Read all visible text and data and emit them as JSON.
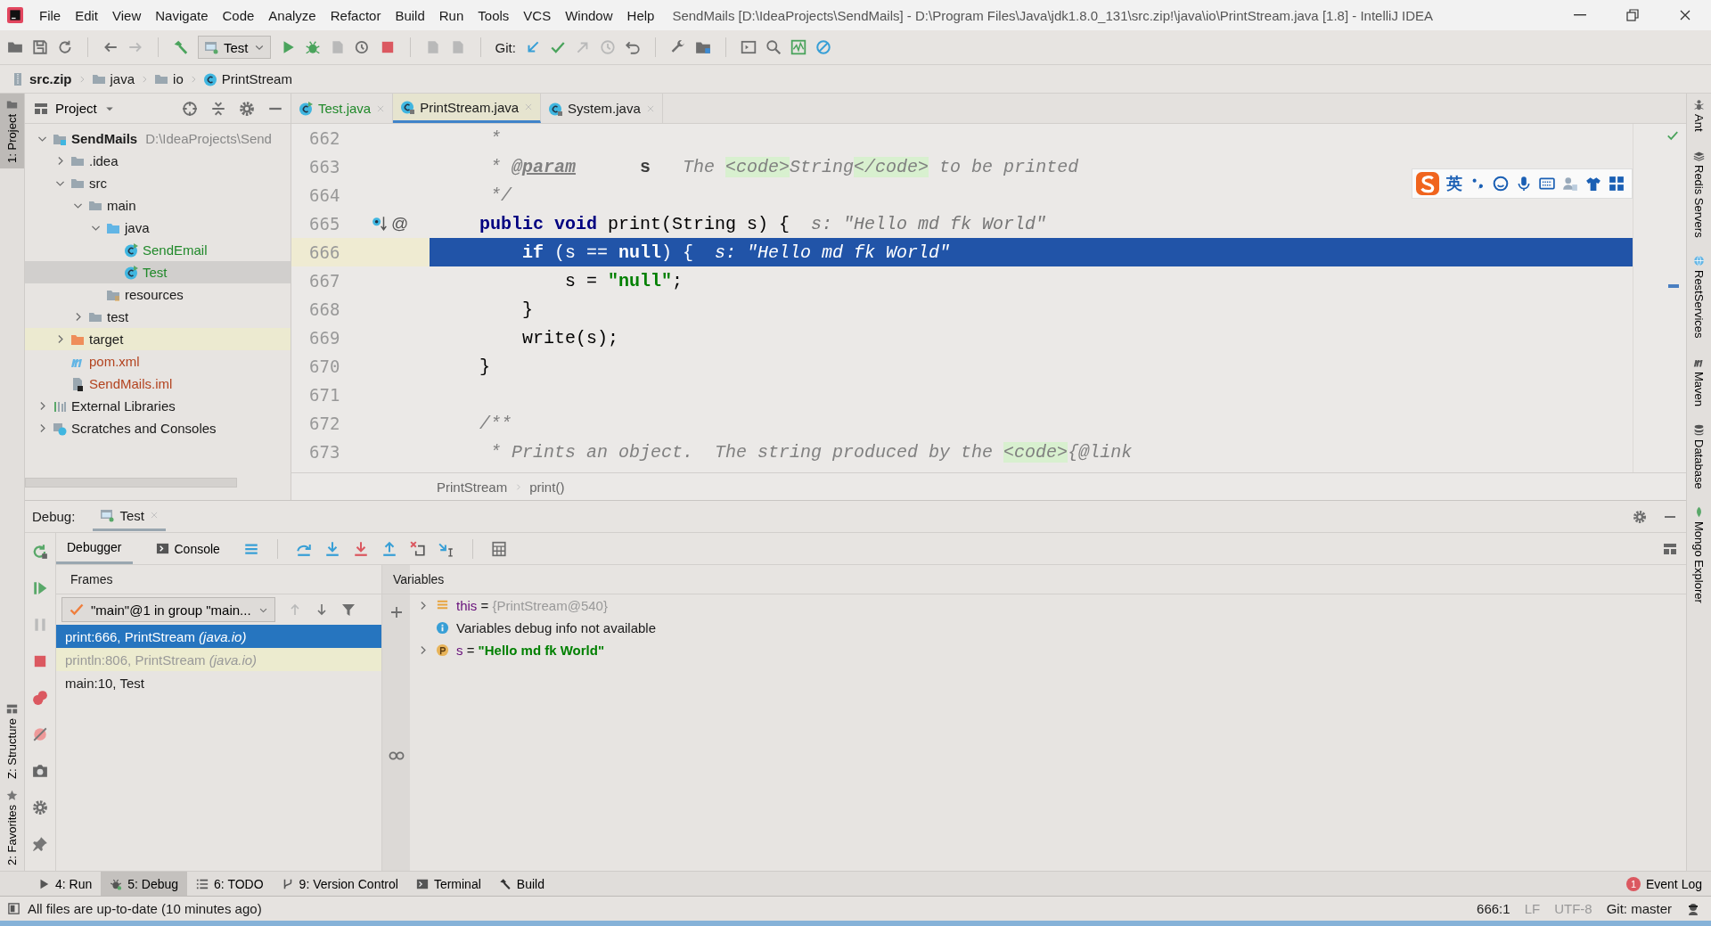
{
  "window": {
    "title": "SendMails [D:\\IdeaProjects\\SendMails] - D:\\Program Files\\Java\\jdk1.8.0_131\\src.zip!\\java\\io\\PrintStream.java [1.8] - IntelliJ IDEA"
  },
  "menu": [
    "File",
    "Edit",
    "View",
    "Navigate",
    "Code",
    "Analyze",
    "Refactor",
    "Build",
    "Run",
    "Tools",
    "VCS",
    "Window",
    "Help"
  ],
  "toolbar": {
    "run_config": "Test",
    "git_label": "Git:"
  },
  "navigation": [
    "src.zip",
    "java",
    "io",
    "PrintStream"
  ],
  "left_stripe": [
    {
      "label": "1: Project",
      "selected": true
    },
    {
      "label": "Z: Structure",
      "selected": false
    },
    {
      "label": "2: Favorites",
      "selected": false
    }
  ],
  "right_stripe": [
    "Ant",
    "Redis Servers",
    "RestServices",
    "Maven",
    "Database",
    "Mongo Explorer"
  ],
  "project": {
    "title": "Project",
    "tree": [
      {
        "label": "SendMails",
        "kind": "module",
        "path": "D:\\IdeaProjects\\Send",
        "expanded": true,
        "selected": false,
        "children": [
          {
            "label": ".idea",
            "kind": "folder",
            "expanded": false,
            "selected": false
          },
          {
            "label": "src",
            "kind": "folder",
            "expanded": true,
            "selected": false,
            "children": [
              {
                "label": "main",
                "kind": "folder",
                "expanded": true,
                "selected": false,
                "children": [
                  {
                    "label": "java",
                    "kind": "source",
                    "expanded": true,
                    "selected": false,
                    "children": [
                      {
                        "label": "SendEmail",
                        "kind": "class",
                        "selected": false
                      },
                      {
                        "label": "Test",
                        "kind": "class",
                        "selected": true
                      }
                    ]
                  },
                  {
                    "label": "resources",
                    "kind": "resources",
                    "selected": false
                  }
                ]
              },
              {
                "label": "test",
                "kind": "folder",
                "expanded": false,
                "selected": false
              }
            ]
          },
          {
            "label": "target",
            "kind": "excluded",
            "expanded": false,
            "selected": false
          },
          {
            "label": "pom.xml",
            "kind": "maven",
            "selected": false
          },
          {
            "label": "SendMails.iml",
            "kind": "iml",
            "selected": false
          }
        ]
      },
      {
        "label": "External Libraries",
        "kind": "libraries",
        "expanded": false,
        "selected": false
      },
      {
        "label": "Scratches and Consoles",
        "kind": "scratches",
        "expanded": false,
        "selected": false
      }
    ]
  },
  "editor": {
    "tabs": [
      {
        "label": "Test.java",
        "kind": "runnable",
        "selected": false
      },
      {
        "label": "PrintStream.java",
        "kind": "library",
        "selected": true
      },
      {
        "label": "System.java",
        "kind": "library",
        "selected": false
      }
    ],
    "lines": [
      {
        "number": "662",
        "current": false,
        "tokens": [
          {
            "kind": "comment",
            "text": "     *"
          }
        ]
      },
      {
        "number": "663",
        "current": false,
        "tokens": [
          {
            "kind": "comment",
            "text": "     * "
          },
          {
            "kind": "doctag",
            "text": "@param"
          },
          {
            "kind": "docparam",
            "text": "      s"
          },
          {
            "kind": "comment",
            "text": "   The "
          },
          {
            "kind": "html",
            "text": "<code>"
          },
          {
            "kind": "comment",
            "text": "String"
          },
          {
            "kind": "html",
            "text": "</code>"
          },
          {
            "kind": "comment",
            "text": " to be printed"
          }
        ]
      },
      {
        "number": "664",
        "current": false,
        "tokens": [
          {
            "kind": "comment",
            "text": "     */"
          }
        ]
      },
      {
        "number": "665",
        "current": false,
        "gutter_symbol": "@",
        "tokens": [
          {
            "kind": "keyword",
            "text": "    public void "
          },
          {
            "kind": "plain",
            "text": "print(String s) {  "
          },
          {
            "kind": "hint",
            "text": "s: \"Hello md fk World\""
          }
        ]
      },
      {
        "number": "666",
        "current": true,
        "tokens": [
          {
            "kind": "keyword",
            "text": "        if "
          },
          {
            "kind": "plain",
            "text": "(s == "
          },
          {
            "kind": "keyword",
            "text": "null"
          },
          {
            "kind": "plain",
            "text": ") {  "
          },
          {
            "kind": "hint",
            "text": "s: \"Hello md fk World\""
          }
        ]
      },
      {
        "number": "667",
        "current": false,
        "tokens": [
          {
            "kind": "plain",
            "text": "            s = "
          },
          {
            "kind": "string",
            "text": "\"null\""
          },
          {
            "kind": "plain",
            "text": ";"
          }
        ]
      },
      {
        "number": "668",
        "current": false,
        "tokens": [
          {
            "kind": "plain",
            "text": "        }"
          }
        ]
      },
      {
        "number": "669",
        "current": false,
        "tokens": [
          {
            "kind": "plain",
            "text": "        write(s);"
          }
        ]
      },
      {
        "number": "670",
        "current": false,
        "tokens": [
          {
            "kind": "plain",
            "text": "    }"
          }
        ]
      },
      {
        "number": "671",
        "current": false
      },
      {
        "number": "672",
        "current": false,
        "tokens": [
          {
            "kind": "comment",
            "text": "    /**"
          }
        ]
      },
      {
        "number": "673",
        "current": false,
        "tokens": [
          {
            "kind": "comment",
            "text": "     * Prints an object.  The string produced by the "
          },
          {
            "kind": "html",
            "text": "<code>"
          },
          {
            "kind": "comment",
            "text": "{@link"
          }
        ]
      }
    ],
    "breadcrumb": [
      "PrintStream",
      "print()"
    ]
  },
  "ime_toolbar": {
    "mode": "英"
  },
  "debug": {
    "title": "Debug:",
    "session": "Test",
    "tabs": [
      {
        "label": "Debugger",
        "selected": true
      },
      {
        "label": "Console",
        "selected": false
      }
    ],
    "frames_title": "Frames",
    "thread": "\"main\"@1 in group \"main...",
    "frames": [
      {
        "method": "print:666, PrintStream",
        "package": "(java.io)",
        "selected": true,
        "dimmed": false
      },
      {
        "method": "println:806, PrintStream",
        "package": "(java.io)",
        "selected": false,
        "dimmed": true
      },
      {
        "method": "main:10, Test",
        "selected": false,
        "dimmed": false
      }
    ],
    "variables_title": "Variables",
    "variables": [
      {
        "kind": "object",
        "name": "this",
        "op": "=",
        "value": "{PrintStream@540}"
      },
      {
        "kind": "info",
        "text": "Variables debug info not available"
      },
      {
        "kind": "param",
        "name": "s",
        "op": "=",
        "value": "\"Hello md fk World\""
      }
    ]
  },
  "bottom_tabs": [
    {
      "label": "4: Run",
      "kind": "run",
      "selected": false
    },
    {
      "label": "5: Debug",
      "kind": "debug",
      "selected": true
    },
    {
      "label": "6: TODO",
      "kind": "todo",
      "selected": false
    },
    {
      "label": "9: Version Control",
      "kind": "vcs",
      "selected": false
    },
    {
      "label": "Terminal",
      "kind": "terminal",
      "selected": false
    },
    {
      "label": "Build",
      "kind": "build",
      "selected": false
    }
  ],
  "event_log": {
    "count": "1",
    "label": "Event Log"
  },
  "status_bar": {
    "message": "All files are up-to-date (10 minutes ago)",
    "position": "666:1",
    "line_separator": "LF",
    "encoding": "UTF-8",
    "vcs": "Git: master"
  }
}
